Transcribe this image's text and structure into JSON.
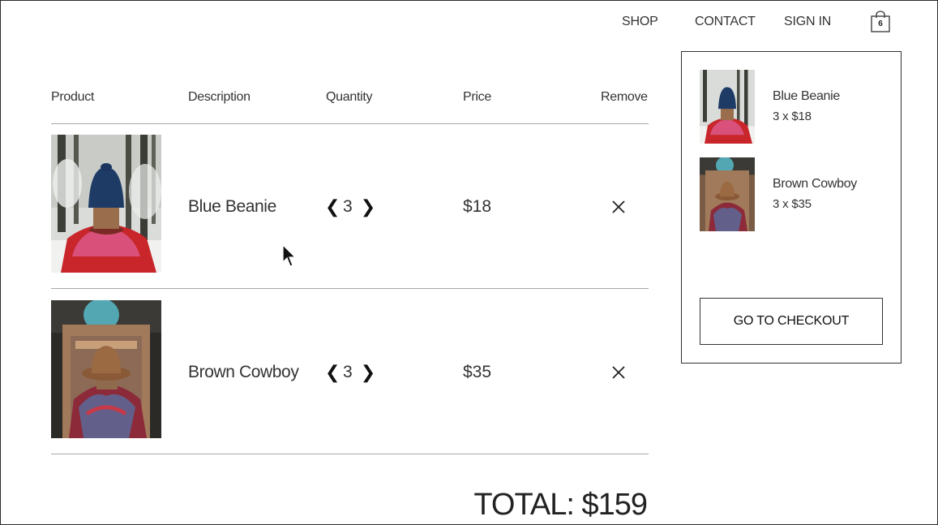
{
  "nav": {
    "shop": "SHOP",
    "contact": "CONTACT",
    "sign_in": "SIGN IN",
    "bag_icon": "shopping-bag-icon",
    "bag_count": "6"
  },
  "table": {
    "headers": [
      "Product",
      "Description",
      "Quantity",
      "Price",
      "Remove"
    ],
    "rows": [
      {
        "name": "Blue Beanie",
        "quantity": "3",
        "price": "$18",
        "image": "person in blue beanie and pink jacket in snowy forest"
      },
      {
        "name": "Brown Cowboy",
        "quantity": "3",
        "price": "$35",
        "image": "person in brown cowboy hat and patterned scarf before ornate building"
      }
    ],
    "decrease_icon": "chevron-left-icon",
    "increase_icon": "chevron-right-icon",
    "remove_icon": "close-icon"
  },
  "total": "TOTAL: $159",
  "mini_cart": {
    "items": [
      {
        "name": "Blue Beanie",
        "qty_price": "3 x $18"
      },
      {
        "name": "Brown Cowboy",
        "qty_price": "3 x $35"
      }
    ],
    "checkout_label": "GO TO CHECKOUT"
  },
  "colors": {
    "text": "#333333",
    "border": "#333333",
    "rule": "#a8a8a8",
    "background": "#ffffff"
  }
}
